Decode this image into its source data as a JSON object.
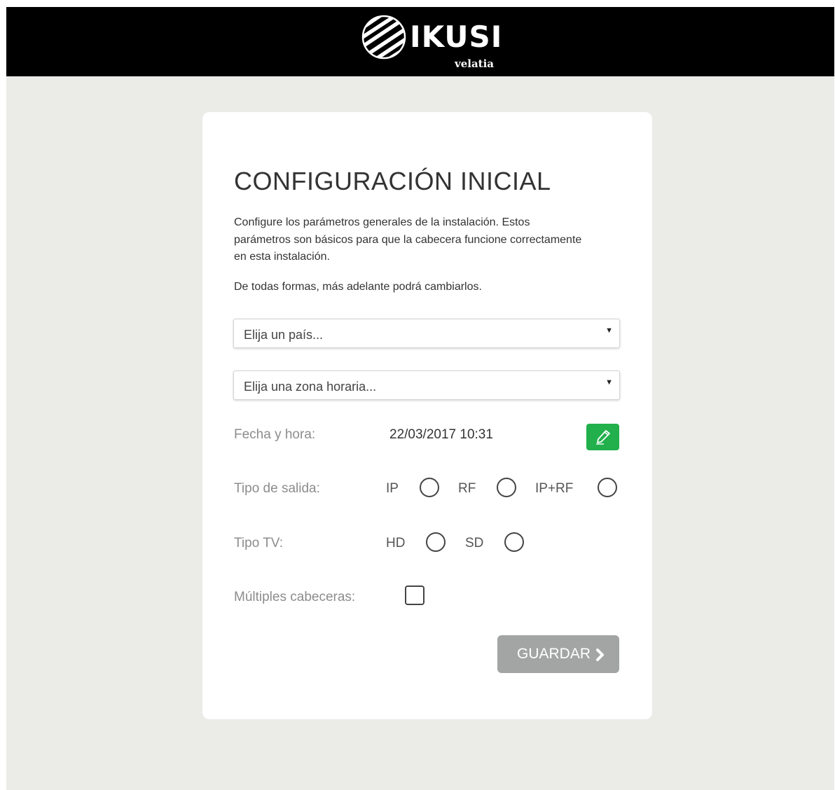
{
  "header": {
    "logo_text": "IKUSI",
    "logo_subtext": "velatia"
  },
  "form": {
    "title": "CONFIGURACIÓN INICIAL",
    "description": "Configure los parámetros generales de la instalación. Estos parámetros son básicos para que la cabecera funcione correctamente en esta instalación.",
    "description2": "De todas formas, más adelante podrá cambiarlos.",
    "country_select": {
      "placeholder": "Elija un país..."
    },
    "timezone_select": {
      "placeholder": "Elija una zona horaria..."
    },
    "datetime": {
      "label": "Fecha y hora:",
      "value": "22/03/2017 10:31"
    },
    "output_type": {
      "label": "Tipo de salida:",
      "options": [
        "IP",
        "RF",
        "IP+RF"
      ]
    },
    "tv_type": {
      "label": "Tipo TV:",
      "options": [
        "HD",
        "SD"
      ]
    },
    "multiple_headends": {
      "label": "Múltiples cabeceras:",
      "checked": false
    },
    "save_label": "GUARDAR"
  },
  "colors": {
    "header_bg": "#000000",
    "page_bg": "#ebebe8",
    "edit_button": "#21b04b",
    "save_button": "#a3a5a5"
  },
  "icons": {
    "edit": "pencil-icon",
    "save": "chevron-right-icon",
    "select": "caret-down-icon",
    "logo": "striped-globe-logo"
  }
}
